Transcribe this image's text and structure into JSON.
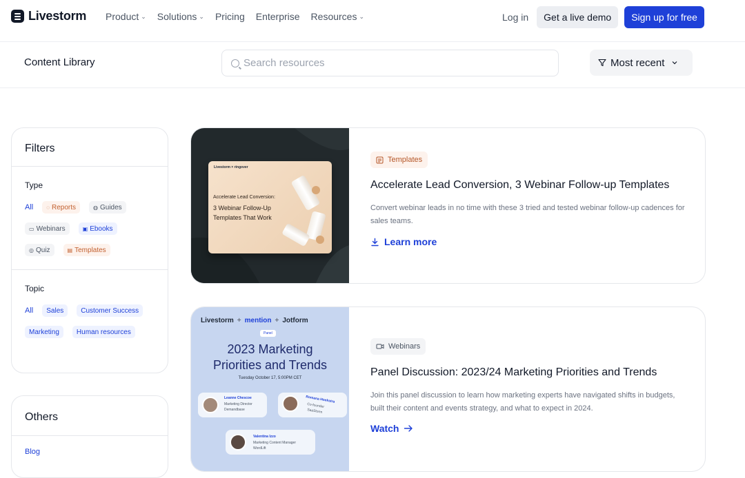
{
  "nav": {
    "logo": "Livestorm",
    "links": [
      {
        "label": "Product",
        "dropdown": true
      },
      {
        "label": "Solutions",
        "dropdown": true
      },
      {
        "label": "Pricing",
        "dropdown": false
      },
      {
        "label": "Enterprise",
        "dropdown": false
      },
      {
        "label": "Resources",
        "dropdown": true
      }
    ],
    "login": "Log in",
    "demo": "Get a live demo",
    "signup": "Sign up for free"
  },
  "subbar": {
    "title": "Content Library",
    "search_placeholder": "Search resources",
    "sort_label": "Most recent"
  },
  "filters": {
    "heading": "Filters",
    "type_label": "Type",
    "type_chips": [
      {
        "label": "All",
        "style": "active",
        "icon": ""
      },
      {
        "label": "Reports",
        "style": "orange",
        "icon": "report-icon"
      },
      {
        "label": "Guides",
        "style": "grey",
        "icon": "guide-icon"
      },
      {
        "label": "Webinars",
        "style": "grey",
        "icon": "video-icon"
      },
      {
        "label": "Ebooks",
        "style": "blue",
        "icon": "book-icon"
      },
      {
        "label": "Quiz",
        "style": "grey",
        "icon": "quiz-icon"
      },
      {
        "label": "Templates",
        "style": "orange",
        "icon": "template-icon"
      }
    ],
    "topic_label": "Topic",
    "topic_chips": [
      {
        "label": "All",
        "style": "active"
      },
      {
        "label": "Sales",
        "style": "blue"
      },
      {
        "label": "Customer Success",
        "style": "blue"
      },
      {
        "label": "Marketing",
        "style": "blue"
      },
      {
        "label": "Human resources",
        "style": "blue"
      }
    ]
  },
  "others": {
    "heading": "Others",
    "link": "Blog"
  },
  "resources": [
    {
      "tag": "Templates",
      "tag_icon": "template-icon",
      "title": "Accelerate Lead Conversion, 3 Webinar Follow-up Templates",
      "description": "Convert webinar leads in no time with these 3 tried and tested webinar follow-up cadences for sales teams.",
      "cta": "Learn more",
      "cta_icon": "download-icon",
      "thumb": {
        "brand": "Livestorm × ringover",
        "subtitle": "Accelerate Lead Conversion:",
        "headline": "3 Webinar Follow-Up Templates That Work"
      }
    },
    {
      "tag": "Webinars",
      "tag_icon": "video-icon",
      "title": "Panel Discussion: 2023/24 Marketing Priorities and Trends",
      "description": "Join this panel discussion to learn how marketing experts have navigated shifts in budgets, built their content and events strategy, and what to expect in 2024.",
      "cta": "Watch",
      "cta_icon": "arrow-right-icon",
      "thumb": {
        "brands": [
          "Livestorm",
          "mention",
          "Jotform"
        ],
        "badge": "Panel",
        "headline_line1": "2023 Marketing",
        "headline_line2": "Priorities and Trends",
        "date": "Tuesday October 17, 5:00PM CET",
        "speakers": [
          {
            "name": "Leanne Chescoe",
            "role": "Marketing Director",
            "company": "Demandbase"
          },
          {
            "name": "Romana Hoekstra",
            "role": "Co-founder",
            "company": "SaaStorm"
          },
          {
            "name": "Valentina Izzo",
            "role": "Marketing Content Manager",
            "company": "WordLift"
          }
        ]
      }
    }
  ]
}
